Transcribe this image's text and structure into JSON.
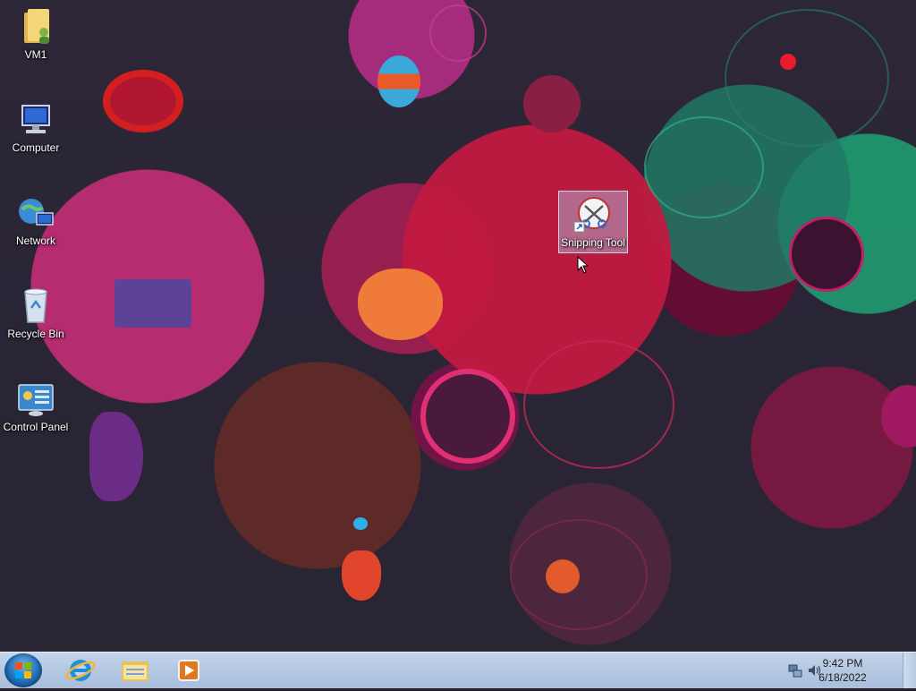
{
  "desktop_icons": {
    "vm1": "VM1",
    "computer": "Computer",
    "network": "Network",
    "recycle_bin": "Recycle Bin",
    "control_panel": "Control Panel",
    "snipping_tool": "Snipping Tool"
  },
  "taskbar": {
    "start_icon": "windows-orb",
    "pinned": [
      "internet-explorer-icon",
      "windows-explorer-icon",
      "media-player-icon"
    ]
  },
  "tray": {
    "time": "9:42 PM",
    "date": "6/18/2022"
  },
  "colors": {
    "taskbar": "#b5c9e2",
    "selection": "#adc7e6",
    "icon_label": "#ffffff"
  }
}
